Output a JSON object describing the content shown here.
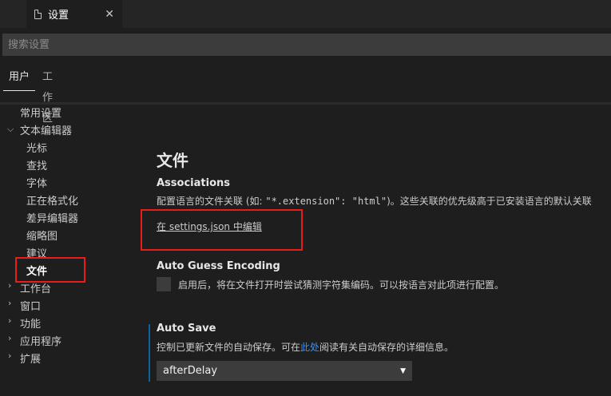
{
  "editor_tab": {
    "label": "设置",
    "close": "✕"
  },
  "search": {
    "placeholder": "搜索设置",
    "value": ""
  },
  "scope_tabs": {
    "user": "用户",
    "workspace": "工作区"
  },
  "toc": {
    "items": [
      {
        "label": "常用设置"
      },
      {
        "label": "文本编辑器",
        "expanded": true
      },
      {
        "label": "光标"
      },
      {
        "label": "查找"
      },
      {
        "label": "字体"
      },
      {
        "label": "正在格式化"
      },
      {
        "label": "差异编辑器"
      },
      {
        "label": "缩略图"
      },
      {
        "label": "建议"
      },
      {
        "label": "文件",
        "selected": true
      },
      {
        "label": "工作台",
        "expanded": false
      },
      {
        "label": "窗口",
        "expanded": false
      },
      {
        "label": "功能",
        "expanded": false
      },
      {
        "label": "应用程序",
        "expanded": false
      },
      {
        "label": "扩展",
        "expanded": false
      }
    ]
  },
  "main": {
    "section_title": "文件",
    "associations": {
      "title": "Associations",
      "desc_prefix": "配置语言的文件关联 (如: ",
      "code1": "\"*.extension\"",
      "colon": ": ",
      "code2": "\"html\"",
      "desc_suffix": ")。这些关联的优先级高于已安装语言的默认关联",
      "edit_link": "在 settings.json 中编辑"
    },
    "auto_guess": {
      "title": "Auto Guess Encoding",
      "checked": false,
      "desc": "启用后，将在文件打开时尝试猜测字符集编码。可以按语言对此项进行配置。"
    },
    "auto_save": {
      "title": "Auto Save",
      "desc_prefix": "控制已更新文件的自动保存。可在",
      "link": "此处",
      "desc_suffix": "阅读有关自动保存的详细信息。",
      "value": "afterDelay",
      "arrow": "▼"
    }
  },
  "colors": {
    "highlight": "#e81c1c",
    "link": "#3794ff",
    "background": "#1e1e1e"
  }
}
